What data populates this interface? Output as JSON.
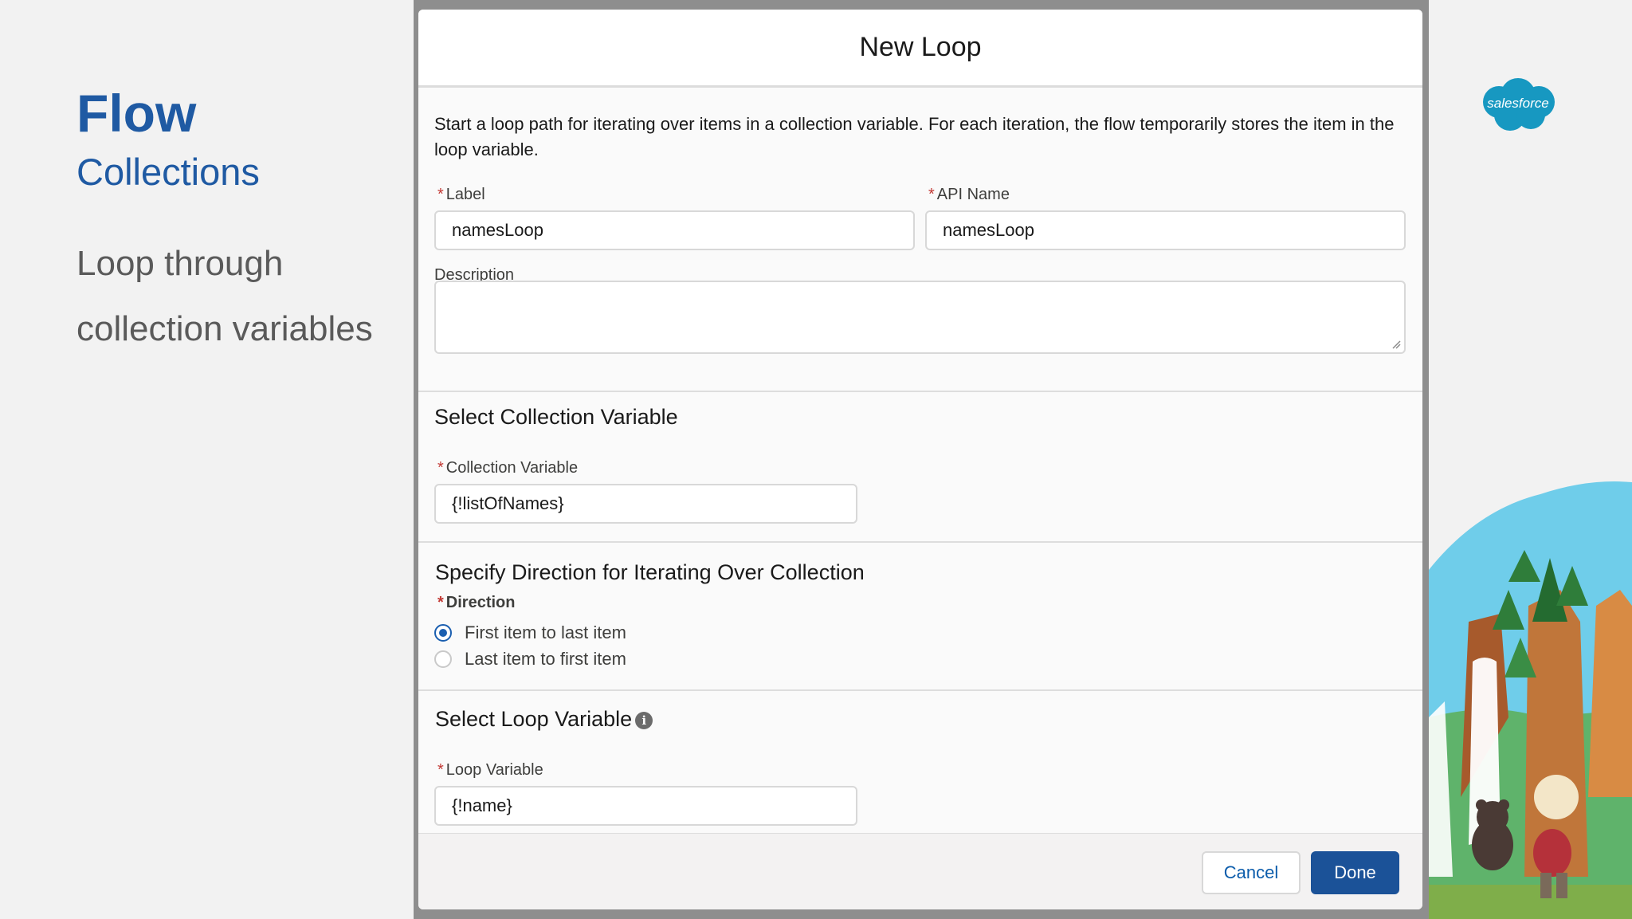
{
  "slide": {
    "title": "Flow",
    "subtitle": "Collections",
    "body_line1": "Loop through",
    "body_line2": "collection variables"
  },
  "brand": {
    "logo_text": "salesforce",
    "color": "#1798c1"
  },
  "modal": {
    "title": "New Loop",
    "description": "Start a loop path for iterating over items in a collection variable. For each iteration, the flow temporarily stores the item in the loop variable.",
    "required_marker": "*",
    "label_field": {
      "label": "Label",
      "value": "namesLoop"
    },
    "api_name_field": {
      "label": "API Name",
      "value": "namesLoop"
    },
    "description_field": {
      "label": "Description",
      "value": ""
    },
    "collection_section": {
      "heading": "Select Collection Variable",
      "field_label": "Collection Variable",
      "value": "{!listOfNames}"
    },
    "direction_section": {
      "heading": "Specify Direction for Iterating Over Collection",
      "field_label": "Direction",
      "options": [
        {
          "label": "First item to last item",
          "selected": true
        },
        {
          "label": "Last item to first item",
          "selected": false
        }
      ]
    },
    "loop_variable_section": {
      "heading": "Select Loop Variable",
      "info_icon": "i",
      "field_label": "Loop Variable",
      "value": "{!name}"
    },
    "footer": {
      "cancel_label": "Cancel",
      "done_label": "Done"
    }
  },
  "colors": {
    "accent_blue": "#1f5aa3",
    "primary_button": "#1b5298",
    "required_red": "#c23934"
  }
}
